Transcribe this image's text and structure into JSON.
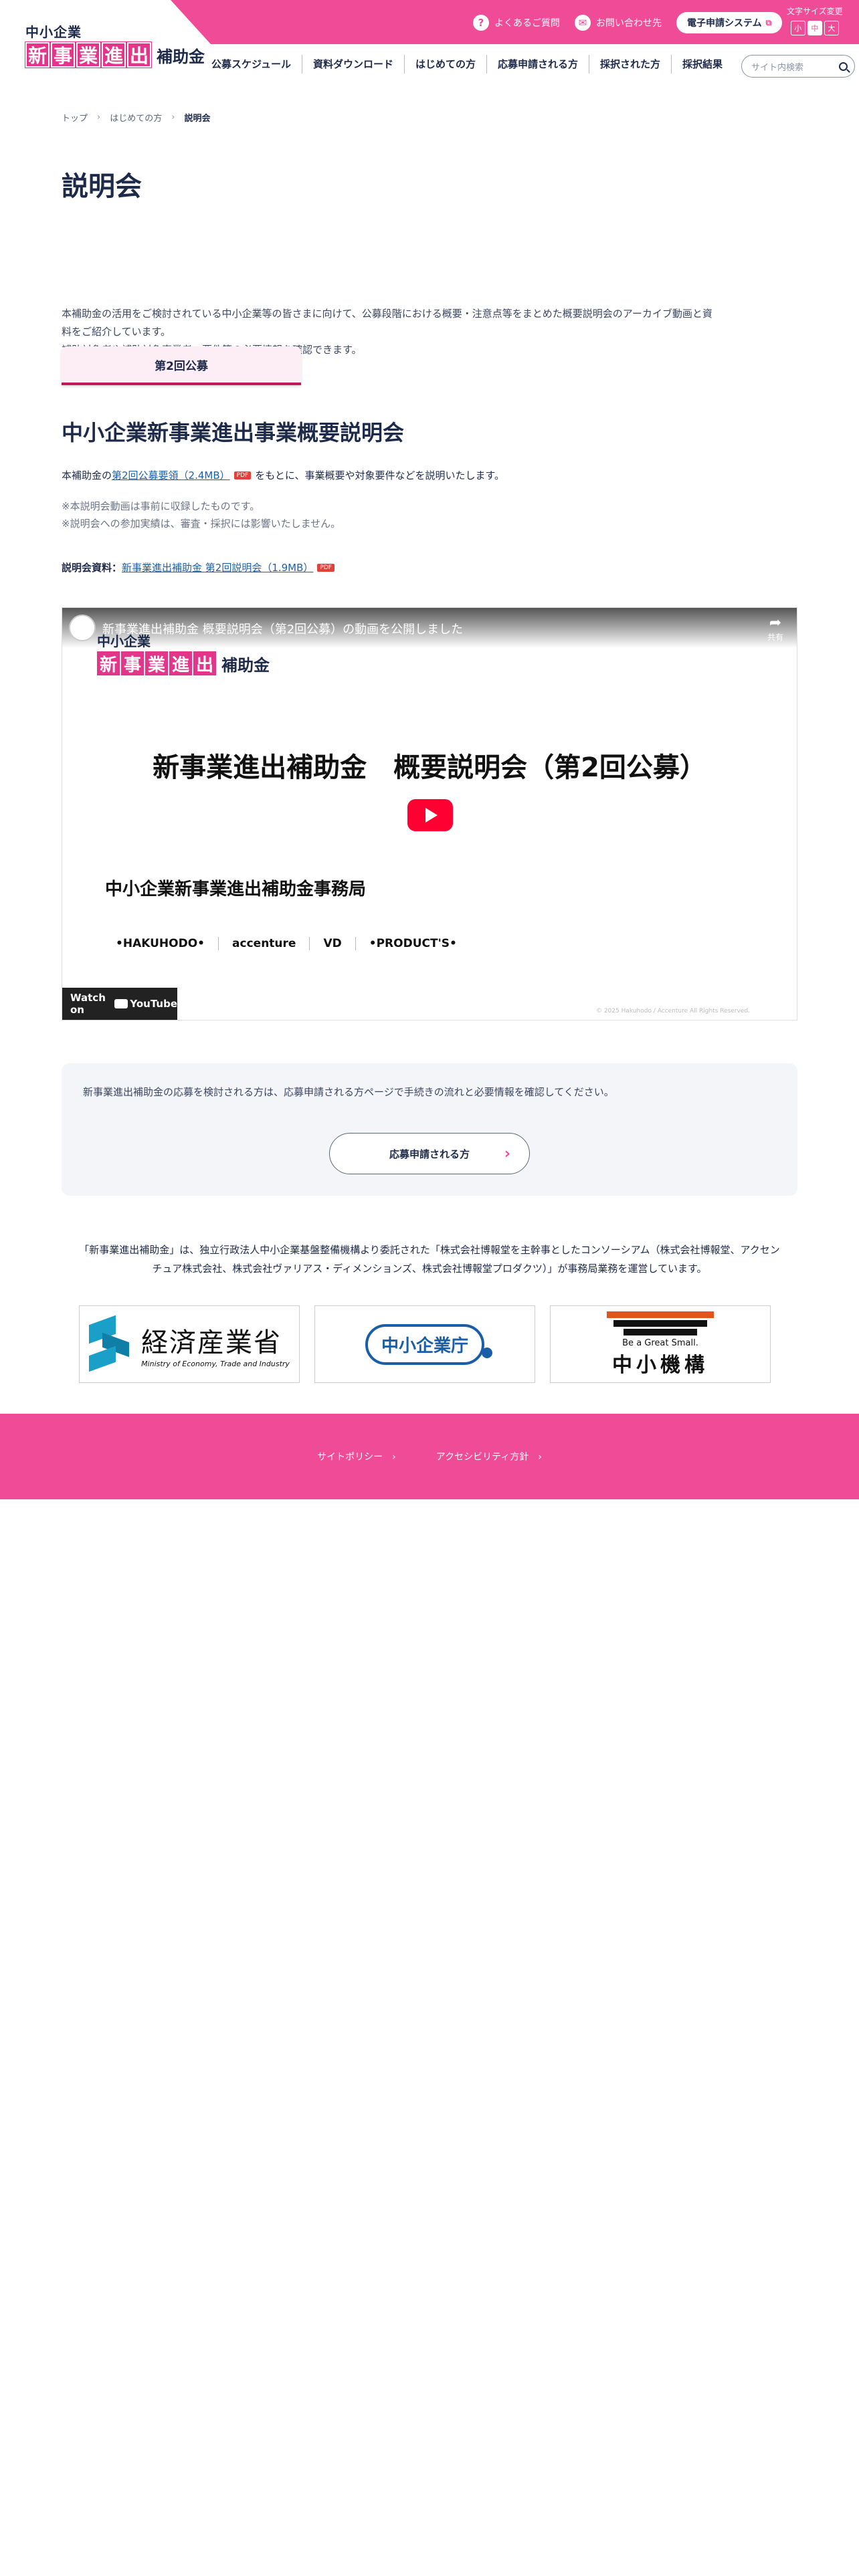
{
  "header": {
    "logo": {
      "line1": "中小企業",
      "boxed": [
        "新",
        "事",
        "業",
        "進",
        "出"
      ],
      "tail": "補助金"
    },
    "util": {
      "faq": "よくあるご質問",
      "contact": "お問い合わせ先",
      "system": "電子申請システム"
    },
    "font_size": {
      "label": "文字サイズ変更",
      "options": [
        "小",
        "中",
        "大"
      ]
    },
    "nav": [
      "公募スケジュール",
      "資料ダウンロード",
      "はじめての方",
      "応募申請される方",
      "採択された方",
      "採択結果"
    ],
    "search_placeholder": "サイト内検索"
  },
  "breadcrumb": [
    "トップ",
    "はじめての方",
    "説明会"
  ],
  "page_title": "説明会",
  "intro": {
    "line1": "本補助金の活用をご検討されている中小企業等の皆さまに向けて、公募段階における概要・注意点等をまとめた概要説明会のアーカイブ動画と資",
    "line2": "料をご紹介しています。",
    "line3": "補助対象者や補助対象事業者、要件等の必要情報を確認できます。"
  },
  "round_tab": "第2回公募",
  "section_title": "中小企業新事業進出事業概要説明会",
  "body": {
    "prefix": "本補助金の",
    "link": "第2回公募要領（2.4MB）",
    "pdf": "PDF",
    "suffix": "をもとに、事業概要や対象要件などを説明いたします。",
    "note1": "※本説明会動画は事前に収録したものです。",
    "note2": "※説明会への参加実績は、審査・採択には影響いたしません。",
    "material_label": "説明会資料：",
    "material_link": "新事業進出補助金 第2回説明会（1.9MB）"
  },
  "video": {
    "title": "新事業進出補助金 概要説明会（第2回公募）の動画を公開しました",
    "share": "共有",
    "logo_line1": "中小企業",
    "logo_boxed": [
      "新",
      "事",
      "業",
      "進",
      "出"
    ],
    "logo_tail": "補助金",
    "main_title": "新事業進出補助金　概要説明会（第2回公募）",
    "office": "中小企業新事業進出補助金事務局",
    "partners": [
      "•HAKUHODO•",
      "accenture",
      "VD",
      "•PRODUCT'S•"
    ],
    "watch_on": "Watch on",
    "youtube": "YouTube",
    "copyright": "© 2025 Hakuhodo / Accenture All Rights Reserved."
  },
  "info_box": {
    "text": "新事業進出補助金の応募を検討される方は、応募申請される方ページで手続きの流れと必要情報を確認してください。",
    "button": "応募申請される方"
  },
  "consortium": {
    "line1": "「新事業進出補助金」は、独立行政法人中小企業基盤整備機構より委託された「株式会社博報堂を主幹事としたコンソーシアム（株式会社博報堂、アクセン",
    "line2": "チュア株式会社、株式会社ヴァリアス・ディメンションズ、株式会社博報堂プロダクツ）」が事務局業務を運営しています。"
  },
  "logos": {
    "meti": {
      "name": "経済産業省",
      "en": "Ministry of Economy, Trade and Industry"
    },
    "chusho": {
      "name": "中小企業庁"
    },
    "smrj": {
      "tag": "Be a Great Small.",
      "name": "中小機構"
    }
  },
  "footer": [
    "サイトポリシー",
    "アクセシビリティ方針"
  ],
  "colors": {
    "brand_pink": "#f04b96",
    "navy": "#1e2a4a",
    "link": "#1f5fa8"
  }
}
